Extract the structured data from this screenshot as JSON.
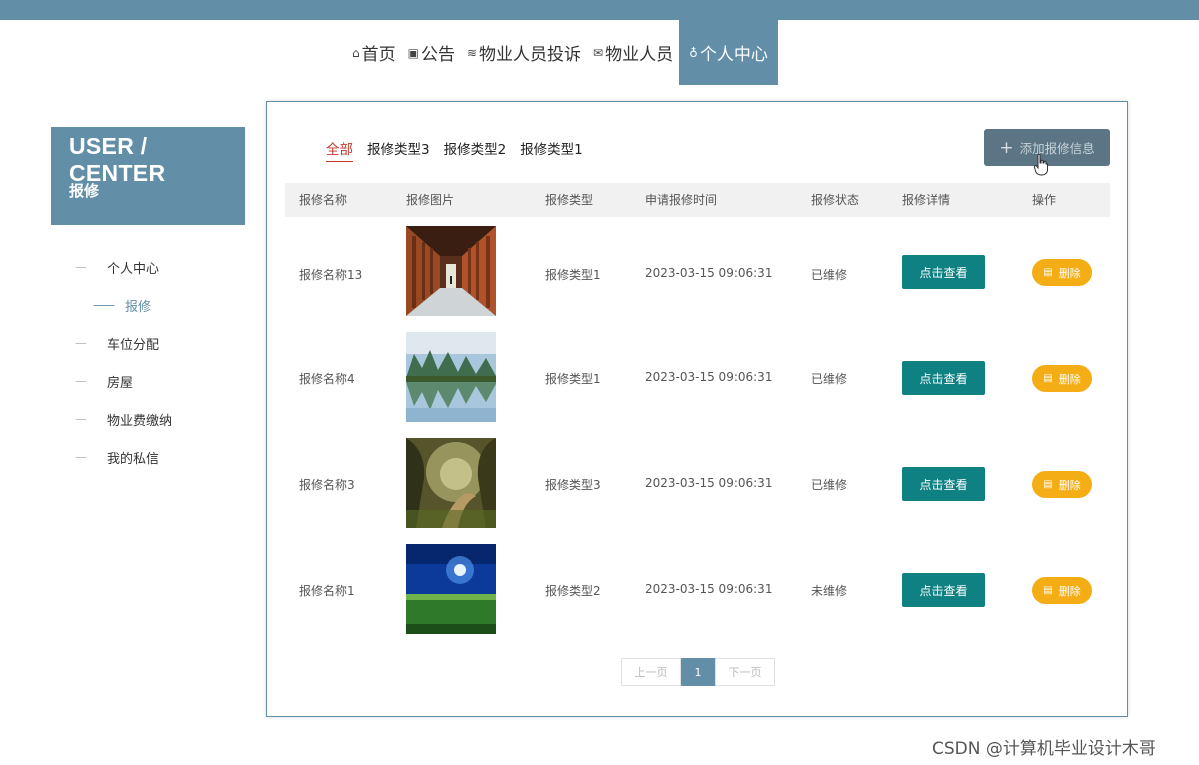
{
  "nav": {
    "items": [
      {
        "icon": "home-icon",
        "glyph": "⌂",
        "label": "首页"
      },
      {
        "icon": "gift-icon",
        "glyph": "▣",
        "label": "公告"
      },
      {
        "icon": "layers-icon",
        "glyph": "≋",
        "label": "物业人员投诉"
      },
      {
        "icon": "mail-icon",
        "glyph": "✉",
        "label": "物业人员"
      },
      {
        "icon": "user-icon",
        "glyph": "♁",
        "label": "个人中心"
      }
    ]
  },
  "sidebar": {
    "title": "USER / CENTER",
    "subtitle": "报修",
    "items": [
      {
        "label": "个人中心"
      },
      {
        "label": "报修"
      },
      {
        "label": "车位分配"
      },
      {
        "label": "房屋"
      },
      {
        "label": "物业费缴纳"
      },
      {
        "label": "我的私信"
      }
    ]
  },
  "tabs": [
    "全部",
    "报修类型3",
    "报修类型2",
    "报修类型1"
  ],
  "add_button": "添加报修信息",
  "table": {
    "headers": [
      "报修名称",
      "报修图片",
      "报修类型",
      "申请报修时间",
      "报修状态",
      "报修详情",
      "操作"
    ],
    "rows": [
      {
        "name": "报修名称13",
        "image": "corridor",
        "type": "报修类型1",
        "time": "2023-03-15 09:06:31",
        "status": "已维修",
        "view": "点击查看",
        "delete": "删除"
      },
      {
        "name": "报修名称4",
        "image": "lake",
        "type": "报修类型1",
        "time": "2023-03-15 09:06:31",
        "status": "已维修",
        "view": "点击查看",
        "delete": "删除"
      },
      {
        "name": "报修名称3",
        "image": "forest-path",
        "type": "报修类型3",
        "time": "2023-03-15 09:06:31",
        "status": "已维修",
        "view": "点击查看",
        "delete": "删除"
      },
      {
        "name": "报修名称1",
        "image": "night-field",
        "type": "报修类型2",
        "time": "2023-03-15 09:06:31",
        "status": "未维修",
        "view": "点击查看",
        "delete": "删除"
      }
    ]
  },
  "pager": {
    "prev": "上一页",
    "current": "1",
    "next": "下一页"
  },
  "watermark": "CSDN @计算机毕业设计木哥",
  "colors": {
    "primary": "#628ea8",
    "view_button": "#0f8183",
    "delete_button": "#f4ad14",
    "active_tab": "#c0392b"
  }
}
